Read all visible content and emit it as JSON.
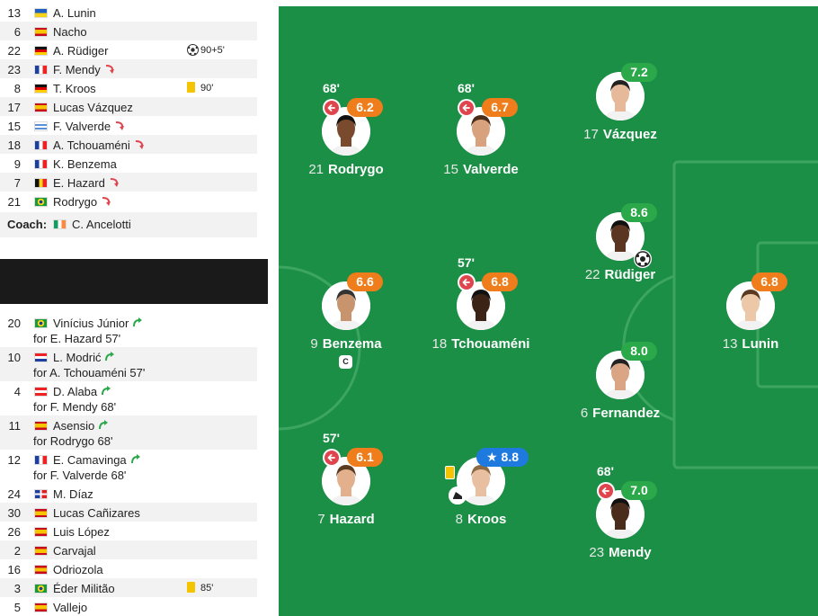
{
  "lineup_top": [
    {
      "num": "13",
      "flag": "ukraine",
      "name": "A. Lunin",
      "subbed": false,
      "event": null
    },
    {
      "num": "6",
      "flag": "spain",
      "name": "Nacho",
      "subbed": false,
      "event": null
    },
    {
      "num": "22",
      "flag": "germany",
      "name": "A. Rüdiger",
      "subbed": false,
      "event": {
        "icon": "football-icon",
        "text": "90+5'"
      }
    },
    {
      "num": "23",
      "flag": "france",
      "name": "F. Mendy",
      "subbed": true,
      "event": null
    },
    {
      "num": "8",
      "flag": "germany",
      "name": "T. Kroos",
      "subbed": false,
      "event": {
        "icon": "yellow-card-icon",
        "text": "90'"
      }
    },
    {
      "num": "17",
      "flag": "spain",
      "name": "Lucas Vázquez",
      "subbed": false,
      "event": null
    },
    {
      "num": "15",
      "flag": "uruguay",
      "name": "F. Valverde",
      "subbed": true,
      "event": null
    },
    {
      "num": "18",
      "flag": "france",
      "name": "A. Tchouaméni",
      "subbed": true,
      "event": null
    },
    {
      "num": "9",
      "flag": "france",
      "name": "K. Benzema",
      "subbed": false,
      "event": null
    },
    {
      "num": "7",
      "flag": "belgium",
      "name": "E. Hazard",
      "subbed": true,
      "event": null
    },
    {
      "num": "21",
      "flag": "brazil",
      "name": "Rodrygo",
      "subbed": true,
      "event": null
    }
  ],
  "coach": {
    "label": "Coach:",
    "flag": "ireland",
    "name": "C. Ancelotti"
  },
  "subs_in": [
    {
      "num": "20",
      "flag": "brazil",
      "name": "Vinícius Júnior",
      "for": "for E. Hazard 57'"
    },
    {
      "num": "10",
      "flag": "croatia",
      "name": "L. Modrić",
      "for": "for A. Tchouaméni 57'"
    },
    {
      "num": "4",
      "flag": "austria",
      "name": "D. Alaba",
      "for": "for F. Mendy 68'"
    },
    {
      "num": "11",
      "flag": "spain",
      "name": "Asensio",
      "for": "for Rodrygo 68'"
    },
    {
      "num": "12",
      "flag": "france",
      "name": "E. Camavinga",
      "for": "for F. Valverde 68'"
    }
  ],
  "bench": [
    {
      "num": "24",
      "flag": "dominican",
      "name": "M. Díaz",
      "event": null
    },
    {
      "num": "30",
      "flag": "spain",
      "name": "Lucas Cañizares",
      "event": null
    },
    {
      "num": "26",
      "flag": "spain",
      "name": "Luis López",
      "event": null
    },
    {
      "num": "2",
      "flag": "spain",
      "name": "Carvajal",
      "event": null
    },
    {
      "num": "16",
      "flag": "spain",
      "name": "Odriozola",
      "event": null
    },
    {
      "num": "3",
      "flag": "brazil",
      "name": "Éder Militão",
      "event": {
        "icon": "yellow-card-icon",
        "text": "85'"
      }
    },
    {
      "num": "5",
      "flag": "spain",
      "name": "Vallejo",
      "event": null
    }
  ],
  "pitch_players": [
    {
      "num": "21",
      "name": "Rodrygo",
      "rating": "6.2",
      "color": "orange",
      "sub_time": "68'",
      "captain": false,
      "goal": false,
      "card": false,
      "assist": false,
      "star": false
    },
    {
      "num": "15",
      "name": "Valverde",
      "rating": "6.7",
      "color": "orange",
      "sub_time": "68'",
      "captain": false,
      "goal": false,
      "card": false,
      "assist": false,
      "star": false
    },
    {
      "num": "17",
      "name": "Vázquez",
      "rating": "7.2",
      "color": "green",
      "sub_time": "",
      "captain": false,
      "goal": false,
      "card": false,
      "assist": false,
      "star": false
    },
    {
      "num": "22",
      "name": "Rüdiger",
      "rating": "8.6",
      "color": "green",
      "sub_time": "",
      "captain": false,
      "goal": true,
      "card": false,
      "assist": false,
      "star": false
    },
    {
      "num": "9",
      "name": "Benzema",
      "rating": "6.6",
      "color": "orange",
      "sub_time": "",
      "captain": true,
      "goal": false,
      "card": false,
      "assist": false,
      "star": false
    },
    {
      "num": "18",
      "name": "Tchouaméni",
      "rating": "6.8",
      "color": "orange",
      "sub_time": "57'",
      "captain": false,
      "goal": false,
      "card": false,
      "assist": false,
      "star": false
    },
    {
      "num": "13",
      "name": "Lunin",
      "rating": "6.8",
      "color": "orange",
      "sub_time": "",
      "captain": false,
      "goal": false,
      "card": false,
      "assist": false,
      "star": false
    },
    {
      "num": "6",
      "name": "Fernandez",
      "rating": "8.0",
      "color": "green",
      "sub_time": "",
      "captain": false,
      "goal": false,
      "card": false,
      "assist": false,
      "star": false
    },
    {
      "num": "7",
      "name": "Hazard",
      "rating": "6.1",
      "color": "orange",
      "sub_time": "57'",
      "captain": false,
      "goal": false,
      "card": false,
      "assist": false,
      "star": false
    },
    {
      "num": "8",
      "name": "Kroos",
      "rating": "8.8",
      "color": "blue",
      "sub_time": "",
      "captain": false,
      "goal": false,
      "card": true,
      "assist": true,
      "star": true
    },
    {
      "num": "23",
      "name": "Mendy",
      "rating": "7.0",
      "color": "green",
      "sub_time": "68'",
      "captain": false,
      "goal": false,
      "card": false,
      "assist": false,
      "star": false
    }
  ],
  "captain_badge": "C",
  "star_glyph": "★",
  "colors": {
    "pitch": "#1a8f45",
    "orange": "#ef7d1b",
    "green": "#2ba84a",
    "blue": "#1f7ae0",
    "sub_out": "#e0454e",
    "sub_arrow_out": "#e0454e",
    "sub_arrow_in": "#2ba84a"
  }
}
